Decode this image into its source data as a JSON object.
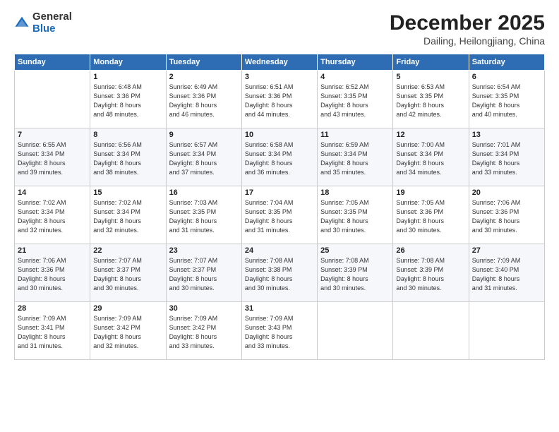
{
  "header": {
    "logo_general": "General",
    "logo_blue": "Blue",
    "month_title": "December 2025",
    "subtitle": "Dailing, Heilongjiang, China"
  },
  "days_of_week": [
    "Sunday",
    "Monday",
    "Tuesday",
    "Wednesday",
    "Thursday",
    "Friday",
    "Saturday"
  ],
  "weeks": [
    [
      {
        "day": "",
        "detail": ""
      },
      {
        "day": "1",
        "detail": "Sunrise: 6:48 AM\nSunset: 3:36 PM\nDaylight: 8 hours\nand 48 minutes."
      },
      {
        "day": "2",
        "detail": "Sunrise: 6:49 AM\nSunset: 3:36 PM\nDaylight: 8 hours\nand 46 minutes."
      },
      {
        "day": "3",
        "detail": "Sunrise: 6:51 AM\nSunset: 3:36 PM\nDaylight: 8 hours\nand 44 minutes."
      },
      {
        "day": "4",
        "detail": "Sunrise: 6:52 AM\nSunset: 3:35 PM\nDaylight: 8 hours\nand 43 minutes."
      },
      {
        "day": "5",
        "detail": "Sunrise: 6:53 AM\nSunset: 3:35 PM\nDaylight: 8 hours\nand 42 minutes."
      },
      {
        "day": "6",
        "detail": "Sunrise: 6:54 AM\nSunset: 3:35 PM\nDaylight: 8 hours\nand 40 minutes."
      }
    ],
    [
      {
        "day": "7",
        "detail": "Sunrise: 6:55 AM\nSunset: 3:34 PM\nDaylight: 8 hours\nand 39 minutes."
      },
      {
        "day": "8",
        "detail": "Sunrise: 6:56 AM\nSunset: 3:34 PM\nDaylight: 8 hours\nand 38 minutes."
      },
      {
        "day": "9",
        "detail": "Sunrise: 6:57 AM\nSunset: 3:34 PM\nDaylight: 8 hours\nand 37 minutes."
      },
      {
        "day": "10",
        "detail": "Sunrise: 6:58 AM\nSunset: 3:34 PM\nDaylight: 8 hours\nand 36 minutes."
      },
      {
        "day": "11",
        "detail": "Sunrise: 6:59 AM\nSunset: 3:34 PM\nDaylight: 8 hours\nand 35 minutes."
      },
      {
        "day": "12",
        "detail": "Sunrise: 7:00 AM\nSunset: 3:34 PM\nDaylight: 8 hours\nand 34 minutes."
      },
      {
        "day": "13",
        "detail": "Sunrise: 7:01 AM\nSunset: 3:34 PM\nDaylight: 8 hours\nand 33 minutes."
      }
    ],
    [
      {
        "day": "14",
        "detail": "Sunrise: 7:02 AM\nSunset: 3:34 PM\nDaylight: 8 hours\nand 32 minutes."
      },
      {
        "day": "15",
        "detail": "Sunrise: 7:02 AM\nSunset: 3:34 PM\nDaylight: 8 hours\nand 32 minutes."
      },
      {
        "day": "16",
        "detail": "Sunrise: 7:03 AM\nSunset: 3:35 PM\nDaylight: 8 hours\nand 31 minutes."
      },
      {
        "day": "17",
        "detail": "Sunrise: 7:04 AM\nSunset: 3:35 PM\nDaylight: 8 hours\nand 31 minutes."
      },
      {
        "day": "18",
        "detail": "Sunrise: 7:05 AM\nSunset: 3:35 PM\nDaylight: 8 hours\nand 30 minutes."
      },
      {
        "day": "19",
        "detail": "Sunrise: 7:05 AM\nSunset: 3:36 PM\nDaylight: 8 hours\nand 30 minutes."
      },
      {
        "day": "20",
        "detail": "Sunrise: 7:06 AM\nSunset: 3:36 PM\nDaylight: 8 hours\nand 30 minutes."
      }
    ],
    [
      {
        "day": "21",
        "detail": "Sunrise: 7:06 AM\nSunset: 3:36 PM\nDaylight: 8 hours\nand 30 minutes."
      },
      {
        "day": "22",
        "detail": "Sunrise: 7:07 AM\nSunset: 3:37 PM\nDaylight: 8 hours\nand 30 minutes."
      },
      {
        "day": "23",
        "detail": "Sunrise: 7:07 AM\nSunset: 3:37 PM\nDaylight: 8 hours\nand 30 minutes."
      },
      {
        "day": "24",
        "detail": "Sunrise: 7:08 AM\nSunset: 3:38 PM\nDaylight: 8 hours\nand 30 minutes."
      },
      {
        "day": "25",
        "detail": "Sunrise: 7:08 AM\nSunset: 3:39 PM\nDaylight: 8 hours\nand 30 minutes."
      },
      {
        "day": "26",
        "detail": "Sunrise: 7:08 AM\nSunset: 3:39 PM\nDaylight: 8 hours\nand 30 minutes."
      },
      {
        "day": "27",
        "detail": "Sunrise: 7:09 AM\nSunset: 3:40 PM\nDaylight: 8 hours\nand 31 minutes."
      }
    ],
    [
      {
        "day": "28",
        "detail": "Sunrise: 7:09 AM\nSunset: 3:41 PM\nDaylight: 8 hours\nand 31 minutes."
      },
      {
        "day": "29",
        "detail": "Sunrise: 7:09 AM\nSunset: 3:42 PM\nDaylight: 8 hours\nand 32 minutes."
      },
      {
        "day": "30",
        "detail": "Sunrise: 7:09 AM\nSunset: 3:42 PM\nDaylight: 8 hours\nand 33 minutes."
      },
      {
        "day": "31",
        "detail": "Sunrise: 7:09 AM\nSunset: 3:43 PM\nDaylight: 8 hours\nand 33 minutes."
      },
      {
        "day": "",
        "detail": ""
      },
      {
        "day": "",
        "detail": ""
      },
      {
        "day": "",
        "detail": ""
      }
    ]
  ]
}
